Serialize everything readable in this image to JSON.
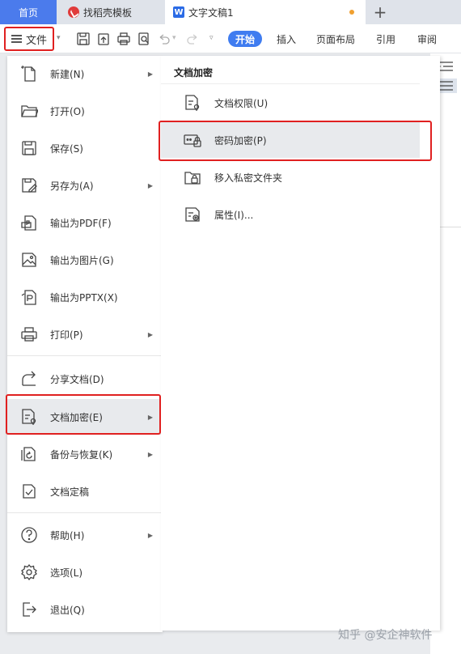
{
  "tabs": {
    "home": "首页",
    "template": "找稻壳模板",
    "document": "文字文稿1",
    "add": "+"
  },
  "toolbar": {
    "file_label": "文件",
    "ribbon_tabs": [
      "开始",
      "插入",
      "页面布局",
      "引用",
      "审阅"
    ],
    "active_tab": "开始"
  },
  "menu": {
    "items": [
      {
        "label": "新建(N)",
        "icon": "new-doc-icon",
        "submenu": true
      },
      {
        "label": "打开(O)",
        "icon": "folder-icon",
        "submenu": false
      },
      {
        "label": "保存(S)",
        "icon": "save-icon",
        "submenu": false
      },
      {
        "label": "另存为(A)",
        "icon": "save-as-icon",
        "submenu": true
      },
      {
        "label": "输出为PDF(F)",
        "icon": "pdf-icon",
        "submenu": false
      },
      {
        "label": "输出为图片(G)",
        "icon": "image-icon",
        "submenu": false
      },
      {
        "label": "输出为PPTX(X)",
        "icon": "pptx-icon",
        "submenu": false
      },
      {
        "label": "打印(P)",
        "icon": "print-icon",
        "submenu": true
      },
      {
        "label": "分享文档(D)",
        "icon": "share-icon",
        "submenu": false
      },
      {
        "label": "文档加密(E)",
        "icon": "encrypt-doc-icon",
        "submenu": true
      },
      {
        "label": "备份与恢复(K)",
        "icon": "backup-icon",
        "submenu": true
      },
      {
        "label": "文档定稿",
        "icon": "finalize-icon",
        "submenu": false
      },
      {
        "label": "帮助(H)",
        "icon": "help-icon",
        "submenu": true
      },
      {
        "label": "选项(L)",
        "icon": "gear-icon",
        "submenu": false
      },
      {
        "label": "退出(Q)",
        "icon": "exit-icon",
        "submenu": false
      }
    ],
    "selected": "文档加密(E)"
  },
  "submenu": {
    "title": "文档加密",
    "items": [
      {
        "label": "文档权限(U)",
        "icon": "doc-permission-icon"
      },
      {
        "label": "密码加密(P)",
        "icon": "password-lock-icon"
      },
      {
        "label": "移入私密文件夹",
        "icon": "private-folder-icon"
      },
      {
        "label": "属性(I)...",
        "icon": "properties-icon"
      }
    ],
    "selected": "密码加密(P)"
  },
  "watermark": "知乎 @安企神软件",
  "colors": {
    "accent": "#3f7cf0",
    "highlight_border": "#e02020",
    "home_tab": "#4b7bec"
  }
}
